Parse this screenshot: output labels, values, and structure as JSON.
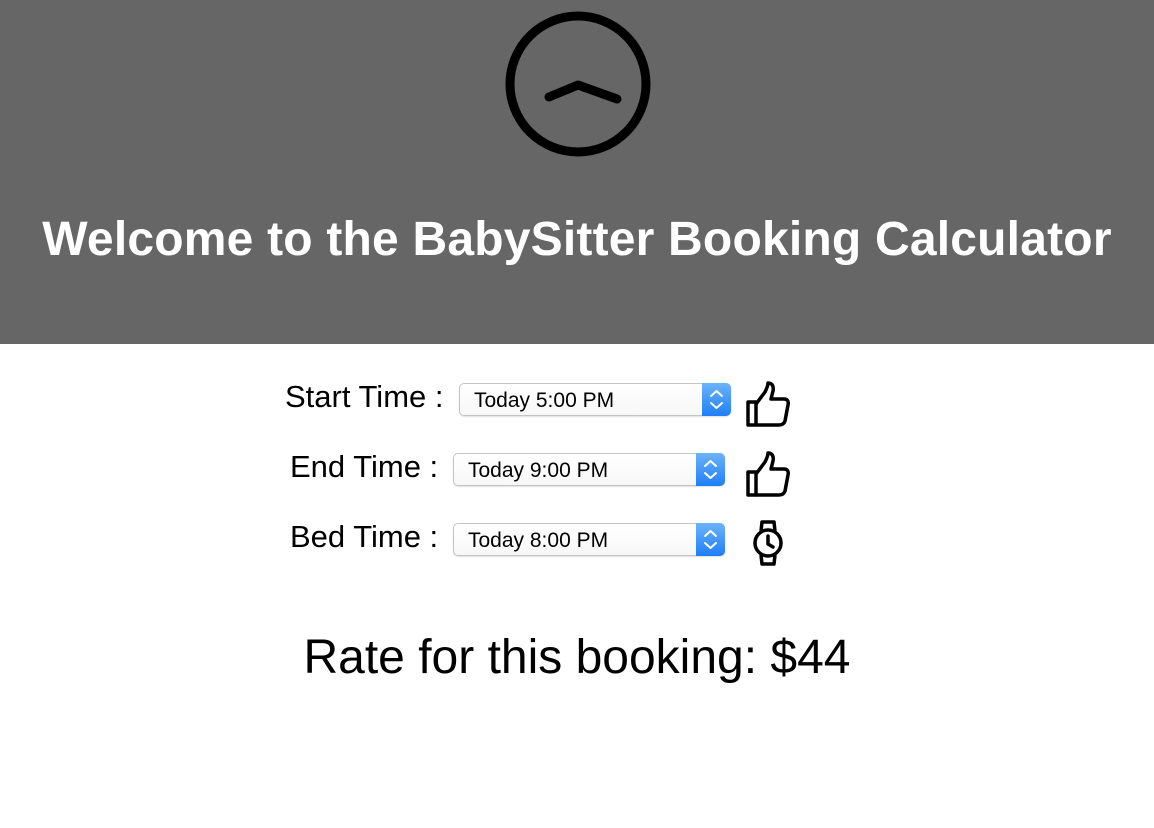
{
  "header": {
    "logo_icon": "chevron-up-circle-icon",
    "title": "Welcome to the BabySitter Booking Calculator",
    "background_color": "#666666"
  },
  "form": {
    "start": {
      "label": "Start Time :",
      "value": "Today 5:00 PM",
      "status_icon": "thumbs-up-icon"
    },
    "end": {
      "label": "End Time :",
      "value": "Today 9:00 PM",
      "status_icon": "thumbs-up-icon"
    },
    "bed": {
      "label": "Bed Time :",
      "value": "Today 8:00 PM",
      "status_icon": "watch-icon"
    }
  },
  "result": {
    "rate_text": "Rate for this booking: $44"
  },
  "colors": {
    "stepper_accent": "#1e7ff6"
  }
}
